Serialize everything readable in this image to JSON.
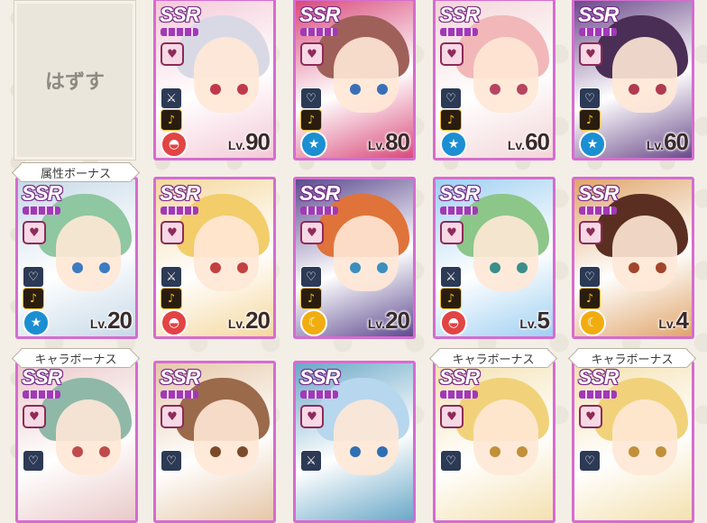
{
  "unequip_label": "はずす",
  "bonus_labels": {
    "attribute": "属性ボーナス",
    "character": "キャラボーナス"
  },
  "cards": [
    {
      "rarity": "SSR",
      "lv": "Lv.",
      "level": "90",
      "attr": "red",
      "attr_icon": "◓",
      "hair": "#d9d9e6",
      "eye": "#c0394a",
      "bg": "#f4c9d7",
      "spirit_icon": "sword-icon"
    },
    {
      "rarity": "SSR",
      "lv": "Lv.",
      "level": "80",
      "attr": "blue",
      "attr_icon": "★",
      "hair": "#a0605a",
      "eye": "#3a6fb8",
      "bg": "#d94a7a",
      "spirit_icon": "heart-icon"
    },
    {
      "rarity": "SSR",
      "lv": "Lv.",
      "level": "60",
      "attr": "blue",
      "attr_icon": "★",
      "hair": "#f2b7b9",
      "eye": "#b7455f",
      "bg": "#f3d5d8",
      "spirit_icon": "heart-icon"
    },
    {
      "rarity": "SSR",
      "lv": "Lv.",
      "level": "60",
      "attr": "blue",
      "attr_icon": "★",
      "hair": "#4a2e55",
      "eye": "#b03a4f",
      "bg": "#6b4a8a",
      "spirit_icon": "heart-icon"
    },
    {
      "rarity": "SSR",
      "lv": "Lv.",
      "level": "20",
      "attr": "blue",
      "attr_icon": "★",
      "hair": "#8ec7a1",
      "eye": "#3a7bc2",
      "bg": "#c6d9e8",
      "spirit_icon": "heart-icon"
    },
    {
      "rarity": "SSR",
      "lv": "Lv.",
      "level": "20",
      "attr": "red",
      "attr_icon": "◓",
      "hair": "#f2cd6a",
      "eye": "#c24040",
      "bg": "#f5d89d",
      "spirit_icon": "sword-icon"
    },
    {
      "rarity": "SSR",
      "lv": "Lv.",
      "level": "20",
      "attr": "gold",
      "attr_icon": "☾",
      "hair": "#e0733a",
      "eye": "#3a8fbf",
      "bg": "#5c4a8f",
      "spirit_icon": "heart-icon"
    },
    {
      "rarity": "SSR",
      "lv": "Lv.",
      "level": "5",
      "attr": "red",
      "attr_icon": "◓",
      "hair": "#8cc689",
      "eye": "#3a8f8a",
      "bg": "#9fd0f2",
      "spirit_icon": "sword-icon"
    },
    {
      "rarity": "SSR",
      "lv": "Lv.",
      "level": "4",
      "attr": "gold",
      "attr_icon": "☾",
      "hair": "#5a2f22",
      "eye": "#a3442c",
      "bg": "#e0a56a",
      "spirit_icon": "heart-icon"
    },
    {
      "rarity": "SSR",
      "lv": "",
      "level": "",
      "attr": "none",
      "attr_icon": "",
      "hair": "#8fb8a8",
      "eye": "#c04a4a",
      "bg": "#eac9c9",
      "spirit_icon": "heart-icon"
    },
    {
      "rarity": "SSR",
      "lv": "",
      "level": "",
      "attr": "none",
      "attr_icon": "",
      "hair": "#9a6a4a",
      "eye": "#7a4a2a",
      "bg": "#e6c7a8",
      "spirit_icon": "heart-icon"
    },
    {
      "rarity": "SSR",
      "lv": "",
      "level": "",
      "attr": "none",
      "attr_icon": "",
      "hair": "#b7d7ee",
      "eye": "#2f6fb3",
      "bg": "#6aa8c8",
      "spirit_icon": "sword-icon"
    },
    {
      "rarity": "SSR",
      "lv": "",
      "level": "",
      "attr": "none",
      "attr_icon": "",
      "hair": "#f1d27a",
      "eye": "#c0903a",
      "bg": "#f4e1b0",
      "spirit_icon": "heart-icon"
    },
    {
      "rarity": "SSR",
      "lv": "",
      "level": "",
      "attr": "none",
      "attr_icon": "",
      "hair": "#f1d27a",
      "eye": "#c0903a",
      "bg": "#f4e1b0",
      "spirit_icon": "heart-icon"
    }
  ]
}
